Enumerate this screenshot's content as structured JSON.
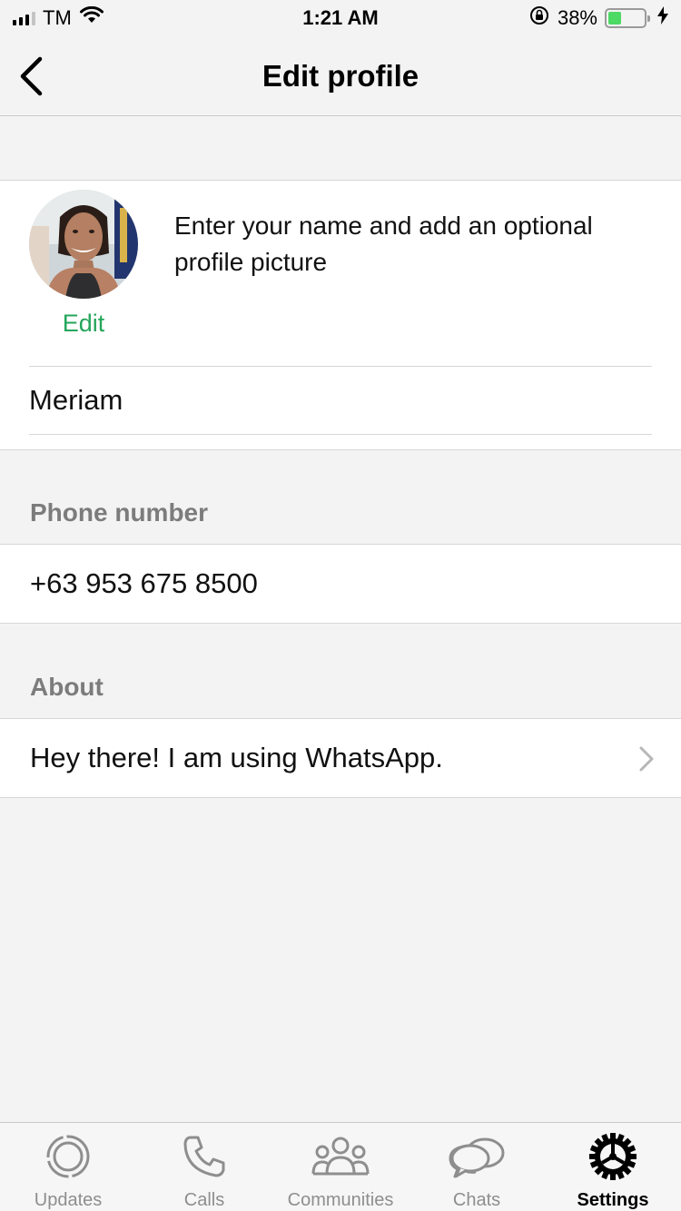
{
  "status_bar": {
    "carrier": "TM",
    "time": "1:21 AM",
    "battery_percent": "38%",
    "battery_level": 0.38,
    "icons": [
      "signal-icon",
      "wifi-icon",
      "rotation-lock-icon",
      "battery-icon",
      "charging-icon"
    ]
  },
  "nav": {
    "title": "Edit profile",
    "back_icon": "chevron-left-icon"
  },
  "profile": {
    "edit_label": "Edit",
    "hint": "Enter your name and add an optional profile picture",
    "name_value": "Meriam"
  },
  "phone": {
    "header": "Phone number",
    "value": "+63 953 675 8500"
  },
  "about": {
    "header": "About",
    "value": "Hey there! I am using WhatsApp."
  },
  "tabs": [
    {
      "label": "Updates",
      "icon": "updates-icon"
    },
    {
      "label": "Calls",
      "icon": "phone-icon"
    },
    {
      "label": "Communities",
      "icon": "communities-icon"
    },
    {
      "label": "Chats",
      "icon": "chats-icon"
    },
    {
      "label": "Settings",
      "icon": "gear-icon",
      "active": true
    }
  ],
  "colors": {
    "accent_green": "#25a65b",
    "battery_green": "#4cd964",
    "background": "#f3f3f3",
    "section_header": "#7c7c7c"
  }
}
